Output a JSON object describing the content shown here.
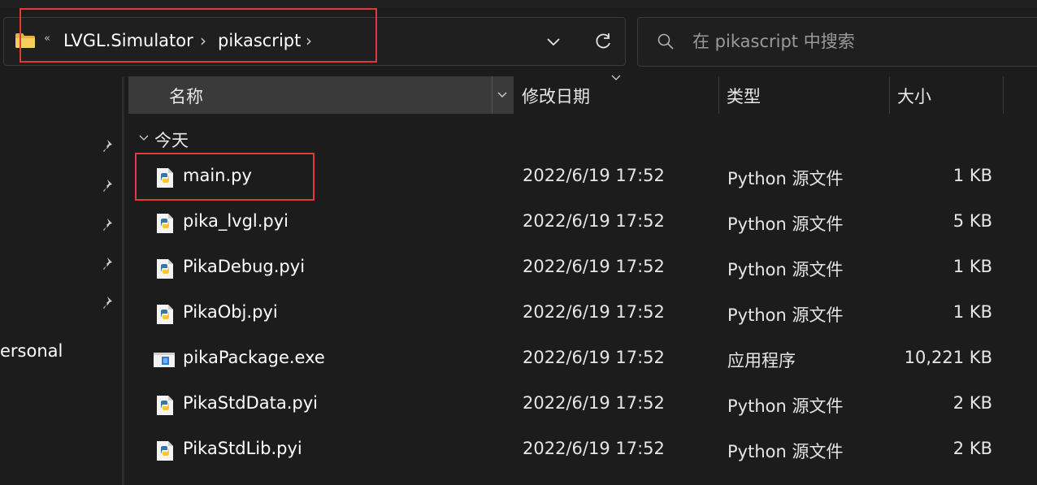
{
  "address_bar": {
    "overflow": "«",
    "breadcrumbs": [
      "LVGL.Simulator",
      "pikascript"
    ],
    "separator": "›",
    "folder_icon": "folder-icon",
    "dropdown_icon": "chevron-down-icon",
    "refresh_icon": "refresh-icon"
  },
  "search": {
    "placeholder": "在 pikascript 中搜索",
    "icon": "search-icon"
  },
  "nav": {
    "pinned_count": 5,
    "item_label": "ersonal"
  },
  "columns": {
    "name": "名称",
    "date": "修改日期",
    "type": "类型",
    "size": "大小"
  },
  "group": {
    "label": "今天"
  },
  "files": [
    {
      "name": "main.py",
      "date": "2022/6/19 17:52",
      "type": "Python 源文件",
      "size": "1 KB",
      "icon": "python-file-icon"
    },
    {
      "name": "pika_lvgl.pyi",
      "date": "2022/6/19 17:52",
      "type": "Python 源文件",
      "size": "5 KB",
      "icon": "python-file-icon"
    },
    {
      "name": "PikaDebug.pyi",
      "date": "2022/6/19 17:52",
      "type": "Python 源文件",
      "size": "1 KB",
      "icon": "python-file-icon"
    },
    {
      "name": "PikaObj.pyi",
      "date": "2022/6/19 17:52",
      "type": "Python 源文件",
      "size": "1 KB",
      "icon": "python-file-icon"
    },
    {
      "name": "pikaPackage.exe",
      "date": "2022/6/19 17:52",
      "type": "应用程序",
      "size": "10,221 KB",
      "icon": "exe-file-icon"
    },
    {
      "name": "PikaStdData.pyi",
      "date": "2022/6/19 17:52",
      "type": "Python 源文件",
      "size": "2 KB",
      "icon": "python-file-icon"
    },
    {
      "name": "PikaStdLib.pyi",
      "date": "2022/6/19 17:52",
      "type": "Python 源文件",
      "size": "2 KB",
      "icon": "python-file-icon"
    }
  ],
  "colors": {
    "background": "#1c1c1c",
    "header_active": "#3a3a3a",
    "highlight": "#e03a3a",
    "folder": "#f2c14e"
  }
}
